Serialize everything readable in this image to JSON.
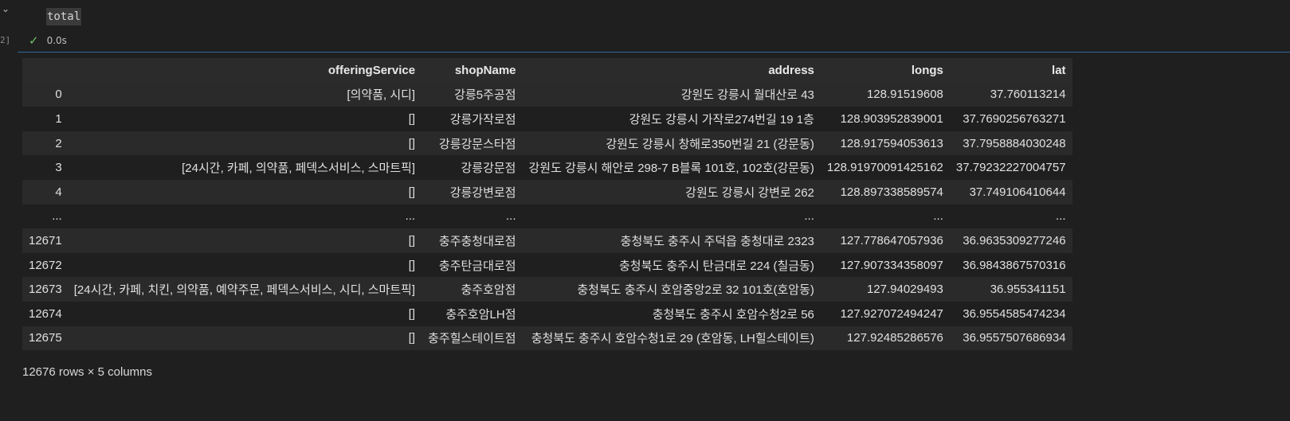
{
  "cell": {
    "code": "total",
    "exec_time": "0.0s",
    "exec_count": "2]"
  },
  "table": {
    "columns": [
      "",
      "offeringService",
      "shopName",
      "address",
      "longs",
      "lat"
    ],
    "rows": [
      [
        "0",
        "[의약품, 시디]",
        "강릉5주공점",
        "강원도 강릉시 월대산로 43",
        "128.91519608",
        "37.760113214"
      ],
      [
        "1",
        "[]",
        "강릉가작로점",
        "강원도 강릉시 가작로274번길 19 1층",
        "128.903952839001",
        "37.7690256763271"
      ],
      [
        "2",
        "[]",
        "강릉강문스타점",
        "강원도 강릉시 창해로350번길 21 (강문동)",
        "128.917594053613",
        "37.7958884030248"
      ],
      [
        "3",
        "[24시간, 카페, 의약품, 페덱스서비스, 스마트픽]",
        "강릉강문점",
        "강원도 강릉시 해안로 298-7 B블록 101호, 102호(강문동)",
        "128.91970091425162",
        "37.79232227004757"
      ],
      [
        "4",
        "[]",
        "강릉강변로점",
        "강원도 강릉시 강변로 262",
        "128.897338589574",
        "37.749106410644"
      ],
      [
        "...",
        "...",
        "...",
        "...",
        "...",
        "..."
      ],
      [
        "12671",
        "[]",
        "충주충청대로점",
        "충청북도 충주시 주덕읍 충청대로 2323",
        "127.778647057936",
        "36.9635309277246"
      ],
      [
        "12672",
        "[]",
        "충주탄금대로점",
        "충청북도 충주시 탄금대로 224 (칠금동)",
        "127.907334358097",
        "36.9843867570316"
      ],
      [
        "12673",
        "[24시간, 카페, 치킨, 의약품, 예약주문, 페덱스서비스, 시디, 스마트픽]",
        "충주호암점",
        "충청북도 충주시 호암중앙2로 32 101호(호암동)",
        "127.94029493",
        "36.955341151"
      ],
      [
        "12674",
        "[]",
        "충주호암LH점",
        "충청북도 충주시 호암수청2로 56",
        "127.927072494247",
        "36.9554585474234"
      ],
      [
        "12675",
        "[]",
        "충주힐스테이트점",
        "충청북도 충주시 호암수청1로 29 (호암동, LH힐스테이트)",
        "127.92485286576",
        "36.9557507686934"
      ]
    ],
    "shape": "12676 rows × 5 columns"
  },
  "icons": {
    "collapse": "chevron-down-icon",
    "status": "check-icon"
  },
  "colors": {
    "background": "#1f1f1f",
    "success": "#6fc36f",
    "focus_border": "#2f6a9a"
  }
}
